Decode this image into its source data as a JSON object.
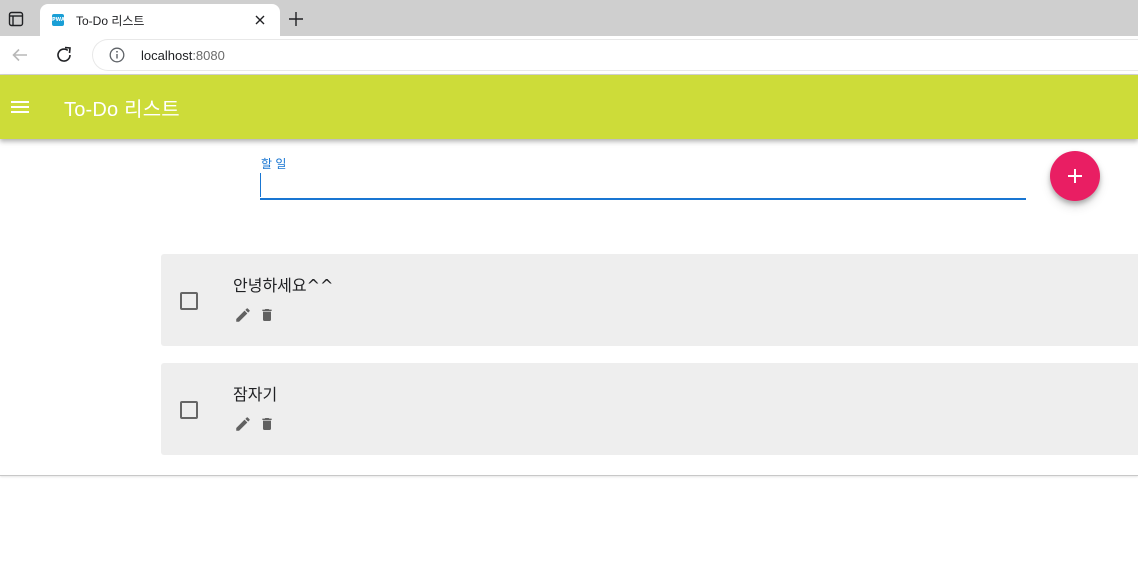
{
  "browser": {
    "tab": {
      "favicon_label": "PWA",
      "title": "To-Do 리스트"
    },
    "address": {
      "host": "localhost",
      "port": ":8080"
    }
  },
  "appbar": {
    "title": "To-Do 리스트"
  },
  "todo_form": {
    "label": "할 일",
    "value": ""
  },
  "todos": [
    {
      "text": "안녕하세요^^",
      "checked": false
    },
    {
      "text": "잠자기",
      "checked": false
    }
  ],
  "colors": {
    "appbar": "#cddc39",
    "fab": "#e91e63",
    "input_accent": "#1976d2",
    "card_bg": "#eeeeee"
  },
  "icons": {
    "menu": "menu-icon",
    "add": "plus-icon",
    "edit": "pencil-icon",
    "delete": "trash-icon"
  }
}
